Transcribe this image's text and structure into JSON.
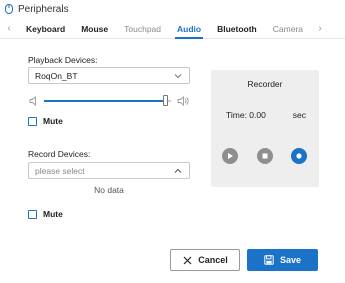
{
  "window": {
    "title": "Peripherals"
  },
  "tabs": {
    "items": [
      {
        "label": "Keyboard",
        "state": "normal"
      },
      {
        "label": "Mouse",
        "state": "normal"
      },
      {
        "label": "Touchpad",
        "state": "disabled"
      },
      {
        "label": "Audio",
        "state": "active"
      },
      {
        "label": "Bluetooth",
        "state": "normal"
      },
      {
        "label": "Camera",
        "state": "disabled"
      }
    ],
    "left_arrow": "‹",
    "right_arrow": "›"
  },
  "playback": {
    "label": "Playback Devices:",
    "selected": "RoqOn_BT",
    "volume_fraction": 0.96,
    "mute_label": "Mute",
    "muted": false
  },
  "record": {
    "label": "Record Devices:",
    "placeholder": "please select",
    "empty_text": "No data",
    "mute_label": "Mute",
    "muted": false
  },
  "recorder": {
    "title": "Recorder",
    "time_text": "Time: 0.00",
    "unit": "sec"
  },
  "actions": {
    "cancel_label": "Cancel",
    "save_label": "Save"
  },
  "colors": {
    "accent": "#1a73c8",
    "recorder_bg": "#eeeeee",
    "control_gray": "#8f8f8f"
  }
}
